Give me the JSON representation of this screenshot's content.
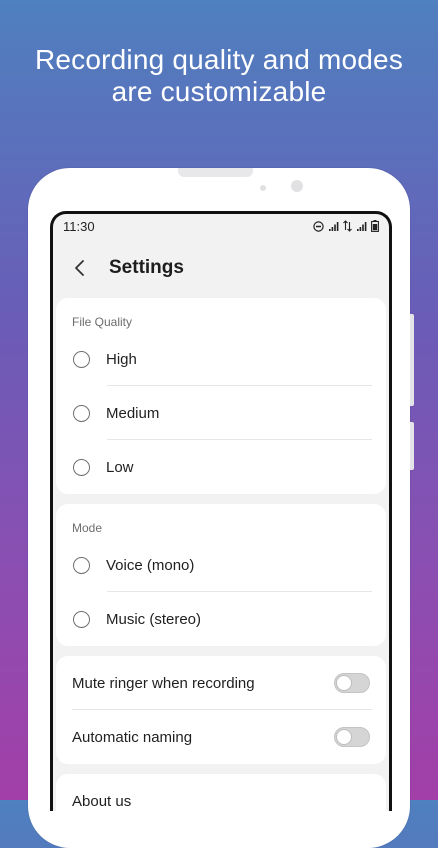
{
  "promo": {
    "headline_line1": "Recording quality and modes",
    "headline_line2": "are customizable"
  },
  "status_bar": {
    "time": "11:30",
    "icons": [
      "do-not-disturb-icon",
      "signal-icon",
      "data-arrows-icon",
      "signal-icon",
      "battery-icon"
    ]
  },
  "app_bar": {
    "title": "Settings",
    "back_icon": "chevron-left-icon"
  },
  "file_quality": {
    "header": "File Quality",
    "options": [
      {
        "label": "High",
        "selected": false
      },
      {
        "label": "Medium",
        "selected": false
      },
      {
        "label": "Low",
        "selected": false
      }
    ]
  },
  "mode": {
    "header": "Mode",
    "options": [
      {
        "label": "Voice (mono)",
        "selected": false
      },
      {
        "label": "Music (stereo)",
        "selected": false
      }
    ]
  },
  "toggles": [
    {
      "label": "Mute ringer when recording",
      "on": false
    },
    {
      "label": "Automatic naming",
      "on": false
    }
  ],
  "about": {
    "label": "About us"
  },
  "colors": {
    "gradient_top": "#4f80bf",
    "gradient_bottom": "#a23fa8",
    "screen_bg": "#f2f2f2",
    "card_bg": "#ffffff"
  }
}
